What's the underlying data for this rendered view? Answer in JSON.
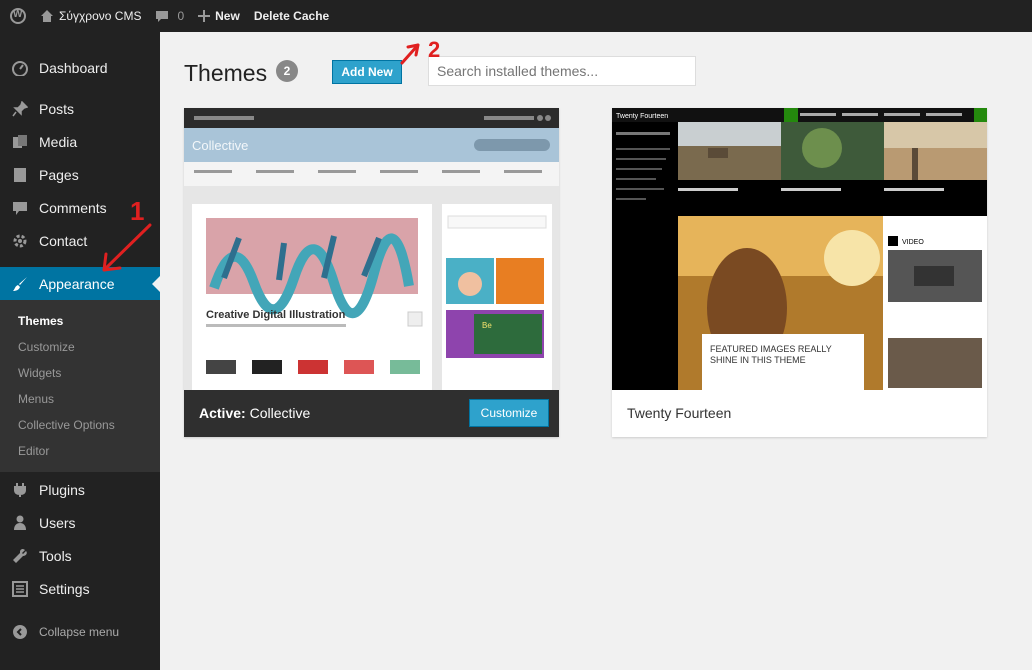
{
  "adminbar": {
    "site_name": "Σύγχρονο CMS",
    "comments_count": "0",
    "new_label": "New",
    "delete_cache_label": "Delete Cache"
  },
  "sidebar": {
    "items": [
      {
        "label": "Dashboard",
        "icon": "dashboard-icon"
      },
      {
        "label": "Posts",
        "icon": "pin-icon"
      },
      {
        "label": "Media",
        "icon": "media-icon"
      },
      {
        "label": "Pages",
        "icon": "pages-icon"
      },
      {
        "label": "Comments",
        "icon": "comment-icon"
      },
      {
        "label": "Contact",
        "icon": "gear-icon"
      },
      {
        "label": "Appearance",
        "icon": "brush-icon"
      },
      {
        "label": "Plugins",
        "icon": "plug-icon"
      },
      {
        "label": "Users",
        "icon": "user-icon"
      },
      {
        "label": "Tools",
        "icon": "wrench-icon"
      },
      {
        "label": "Settings",
        "icon": "settings-icon"
      },
      {
        "label": "Collapse menu",
        "icon": "collapse-icon"
      }
    ],
    "submenu": [
      "Themes",
      "Customize",
      "Widgets",
      "Menus",
      "Collective Options",
      "Editor"
    ]
  },
  "main": {
    "title": "Themes",
    "count": "2",
    "add_new_label": "Add New",
    "search_placeholder": "Search installed themes..."
  },
  "annotations": [
    "1",
    "2"
  ],
  "themes": [
    {
      "name": "Collective",
      "active_prefix": "Active:",
      "customize_label": "Customize",
      "preview": {
        "site_title": "Collective",
        "feature_title": "Creative Digital Illustration"
      }
    },
    {
      "name": "Twenty Fourteen",
      "preview": {
        "site_title": "Twenty Fourteen",
        "featured_text": "FEATURED IMAGES REALLY SHINE IN THIS THEME",
        "video_label": "VIDEO"
      }
    }
  ],
  "colors": {
    "admin_dark": "#222222",
    "accent_blue": "#0074a2",
    "button_blue": "#2ea2cc",
    "annotation_red": "#e02020"
  }
}
